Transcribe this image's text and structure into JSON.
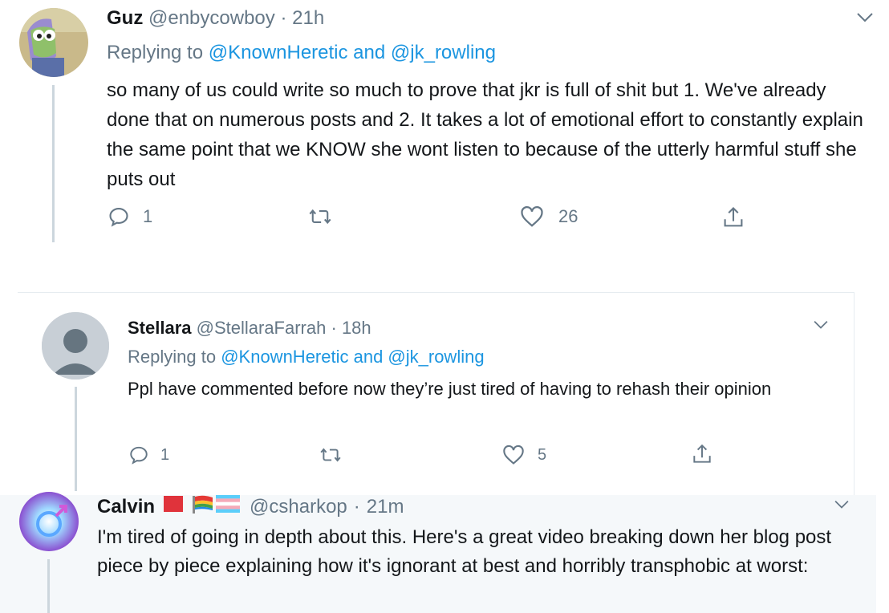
{
  "tweets": [
    {
      "display_name": "Guz",
      "handle": "@enbycowboy",
      "separator": "·",
      "time": "21h",
      "replying_prefix": "Replying to",
      "replying_to": "@KnownHeretic and @jk_rowling",
      "text": "so many of us could write so much to prove that jkr is full of shit but 1. We've already done that on numerous posts and 2. It takes a lot of emotional effort to constantly explain the same point that we KNOW she wont listen to because of the utterly harmful stuff she puts out",
      "reply_count": "1",
      "retweet_count": "",
      "like_count": "26"
    },
    {
      "display_name": "Stellara",
      "handle": "@StellaraFarrah",
      "separator": "·",
      "time": "18h",
      "replying_prefix": "Replying to",
      "replying_to": "@KnownHeretic and @jk_rowling",
      "text": "Ppl have commented before now they’re just tired of having to rehash their opinion",
      "reply_count": "1",
      "retweet_count": "",
      "like_count": "5"
    },
    {
      "display_name": "Calvin",
      "handle": "@csharkop",
      "separator": "·",
      "time": "21m",
      "text": "I'm tired of going in depth about this. Here's a great video breaking down her blog post piece by piece explaining how it's ignorant at best and horribly transphobic at worst:"
    }
  ],
  "icons": {
    "reply": "reply-icon",
    "retweet": "retweet-icon",
    "like": "like-icon",
    "share": "share-icon",
    "more": "chevron-down-icon"
  },
  "colors": {
    "link": "#1b95e0",
    "muted": "#657786",
    "highlight_bg": "#f5f8fa"
  }
}
